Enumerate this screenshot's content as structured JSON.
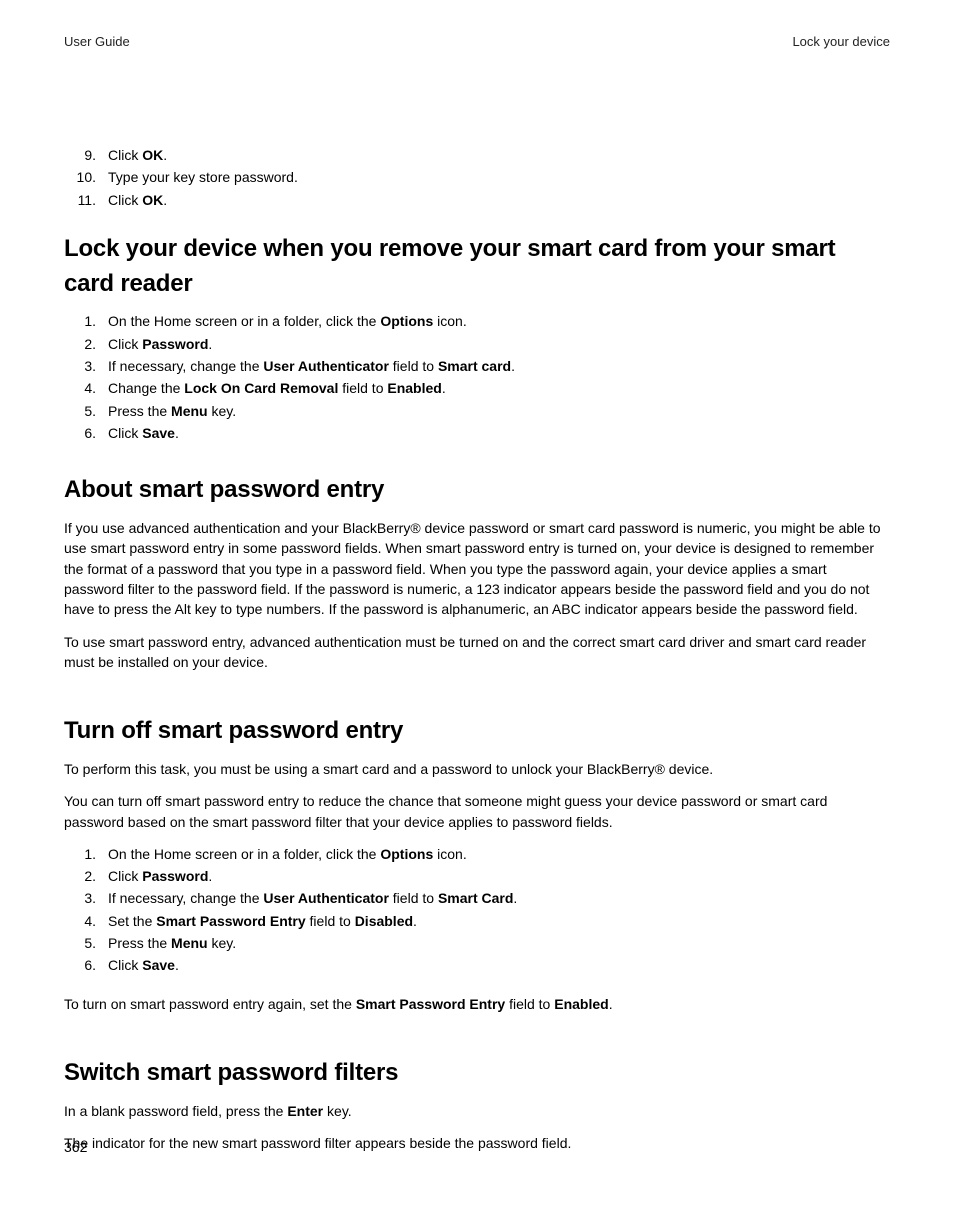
{
  "header": {
    "left": "User Guide",
    "right": "Lock your device"
  },
  "top_steps": [
    {
      "n": "9.",
      "pre": "Click ",
      "b": "OK",
      "post": "."
    },
    {
      "n": "10.",
      "pre": "Type your key store password.",
      "b": "",
      "post": ""
    },
    {
      "n": "11.",
      "pre": "Click ",
      "b": "OK",
      "post": "."
    }
  ],
  "section1": {
    "title": "Lock your device when you remove your smart card from your smart card reader",
    "steps": [
      {
        "n": "1.",
        "pre": "On the Home screen or in a folder, click the ",
        "b": "Options",
        "post": " icon."
      },
      {
        "n": "2.",
        "pre": "Click ",
        "b": "Password",
        "post": "."
      },
      {
        "n": "3.",
        "pre": "If necessary, change the ",
        "b": "User Authenticator",
        "post": " field to ",
        "b2": "Smart card",
        "post2": "."
      },
      {
        "n": "4.",
        "pre": "Change the ",
        "b": "Lock On Card Removal",
        "post": " field to ",
        "b2": "Enabled",
        "post2": "."
      },
      {
        "n": "5.",
        "pre": "Press the ",
        "b": "Menu",
        "post": " key."
      },
      {
        "n": "6.",
        "pre": "Click ",
        "b": "Save",
        "post": "."
      }
    ]
  },
  "section2": {
    "title": "About smart password entry",
    "para1": "If you use advanced authentication and your BlackBerry® device password or smart card password is numeric, you might be able to use smart password entry in some password fields. When smart password entry is turned on, your device is designed to remember the format of a password that you type in a password field. When you type the password again, your device applies a smart password filter to the password field. If the password is numeric, a 123 indicator appears beside the password field and you do not have to press the Alt key to type numbers. If the password is alphanumeric, an ABC indicator appears beside the password field.",
    "para2": "To use smart password entry, advanced authentication must be turned on and the correct smart card driver and smart card reader must be installed on your device."
  },
  "section3": {
    "title": "Turn off smart password entry",
    "para1": "To perform this task, you must be using a smart card and a password to unlock your BlackBerry® device.",
    "para2": "You can turn off smart password entry to reduce the chance that someone might guess your device password or smart card password based on the smart password filter that your device applies to password fields.",
    "steps": [
      {
        "n": "1.",
        "pre": "On the Home screen or in a folder, click the ",
        "b": "Options",
        "post": " icon."
      },
      {
        "n": "2.",
        "pre": "Click ",
        "b": "Password",
        "post": "."
      },
      {
        "n": "3.",
        "pre": "If necessary, change the ",
        "b": "User Authenticator",
        "post": " field to ",
        "b2": "Smart Card",
        "post2": "."
      },
      {
        "n": "4.",
        "pre": "Set the ",
        "b": "Smart Password Entry",
        "post": " field to ",
        "b2": "Disabled",
        "post2": "."
      },
      {
        "n": "5.",
        "pre": "Press the ",
        "b": "Menu",
        "post": " key."
      },
      {
        "n": "6.",
        "pre": "Click ",
        "b": "Save",
        "post": "."
      }
    ],
    "para3_pre": "To turn on smart password entry again, set the ",
    "para3_b1": "Smart Password Entry",
    "para3_mid": " field to ",
    "para3_b2": "Enabled",
    "para3_post": "."
  },
  "section4": {
    "title": "Switch smart password filters",
    "para1_pre": "In a blank password field, press the ",
    "para1_b": "Enter",
    "para1_post": " key.",
    "para2": "The indicator for the new smart password filter appears beside the password field."
  },
  "page_number": "362"
}
